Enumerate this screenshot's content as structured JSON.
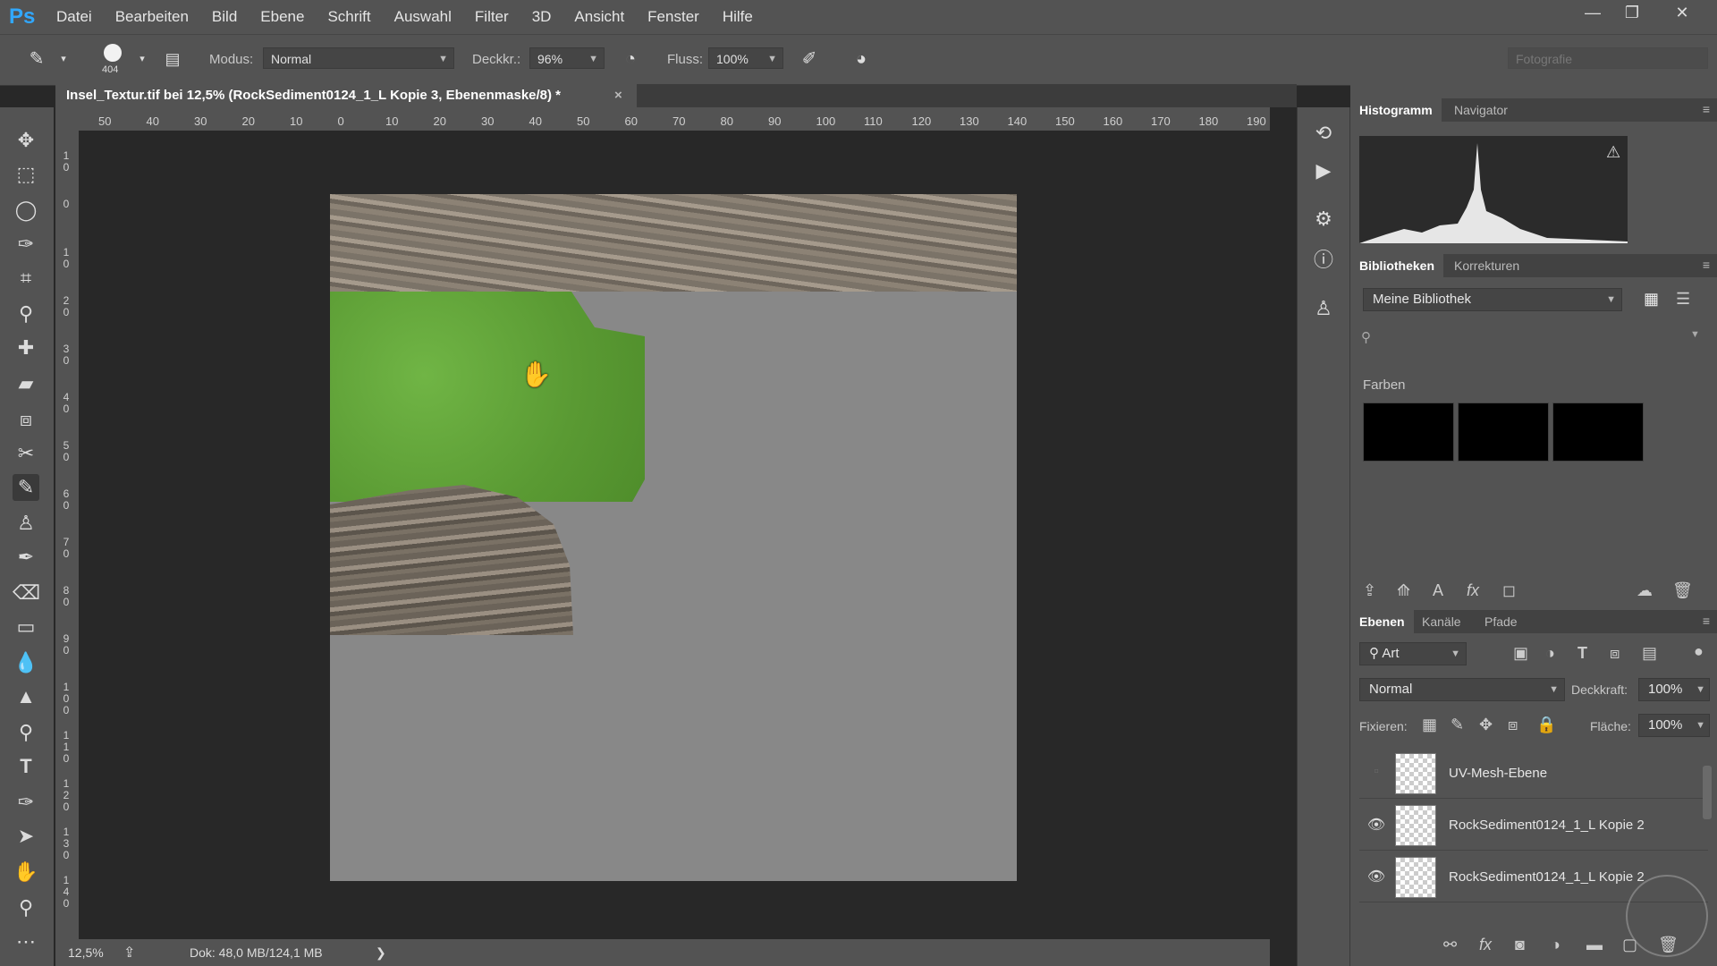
{
  "app": {
    "logo": "Ps"
  },
  "menu": [
    "Datei",
    "Bearbeiten",
    "Bild",
    "Ebene",
    "Schrift",
    "Auswahl",
    "Filter",
    "3D",
    "Ansicht",
    "Fenster",
    "Hilfe"
  ],
  "window": {
    "minimize": "—",
    "restore": "❐",
    "close": "✕"
  },
  "options": {
    "brush_size": "404",
    "mode_label": "Modus:",
    "mode_value": "Normal",
    "opacity_label": "Deckkr.:",
    "opacity_value": "96%",
    "flow_label": "Fluss:",
    "flow_value": "100%",
    "workspace": "Fotografie"
  },
  "document_tab": {
    "title": "Insel_Textur.tif bei 12,5% (RockSediment0124_1_L Kopie 3, Ebenenmaske/8) *",
    "close": "×"
  },
  "ruler_top": [
    "50",
    "40",
    "30",
    "20",
    "10",
    "0",
    "10",
    "20",
    "30",
    "40",
    "50",
    "60",
    "70",
    "80",
    "90",
    "100",
    "110",
    "120",
    "130",
    "140",
    "150",
    "160",
    "170",
    "180",
    "190"
  ],
  "ruler_left": [
    "1\n0",
    "0",
    "1\n0",
    "2\n0",
    "3\n0",
    "4\n0",
    "5\n0",
    "6\n0",
    "7\n0",
    "8\n0",
    "9\n0",
    "1\n0\n0",
    "1\n1\n0",
    "1\n2\n0",
    "1\n3\n0",
    "1\n4\n0"
  ],
  "status": {
    "zoom": "12,5%",
    "doc": "Dok: 48,0 MB/124,1 MB",
    "arrow": "❯"
  },
  "panels": {
    "histogram_tab": "Histogramm",
    "navigator_tab": "Navigator",
    "libraries_tab": "Bibliotheken",
    "adjustments_tab": "Korrekturen",
    "library_value": "Meine Bibliothek",
    "colors_label": "Farben",
    "layers_tab": "Ebenen",
    "channels_tab": "Kanäle",
    "paths_tab": "Pfade",
    "filter_kind": "Art",
    "blend_mode": "Normal",
    "opacity_label": "Deckkraft:",
    "opacity_value": "100%",
    "lock_label": "Fixieren:",
    "fill_label": "Fläche:",
    "fill_value": "100%"
  },
  "swatches": [
    "#000000",
    "#000000",
    "#000000"
  ],
  "layers": [
    {
      "name": "UV-Mesh-Ebene",
      "visible": false
    },
    {
      "name": "RockSediment0124_1_L Kopie 2",
      "visible": true
    },
    {
      "name": "RockSediment0124_1_L Kopie 2",
      "visible": true
    }
  ],
  "colors": {
    "canvas_bg": "#282828",
    "panel": "#535353",
    "document_gray": "#888888",
    "grass": "#5fa33a",
    "ps_blue": "#31a8ff"
  }
}
